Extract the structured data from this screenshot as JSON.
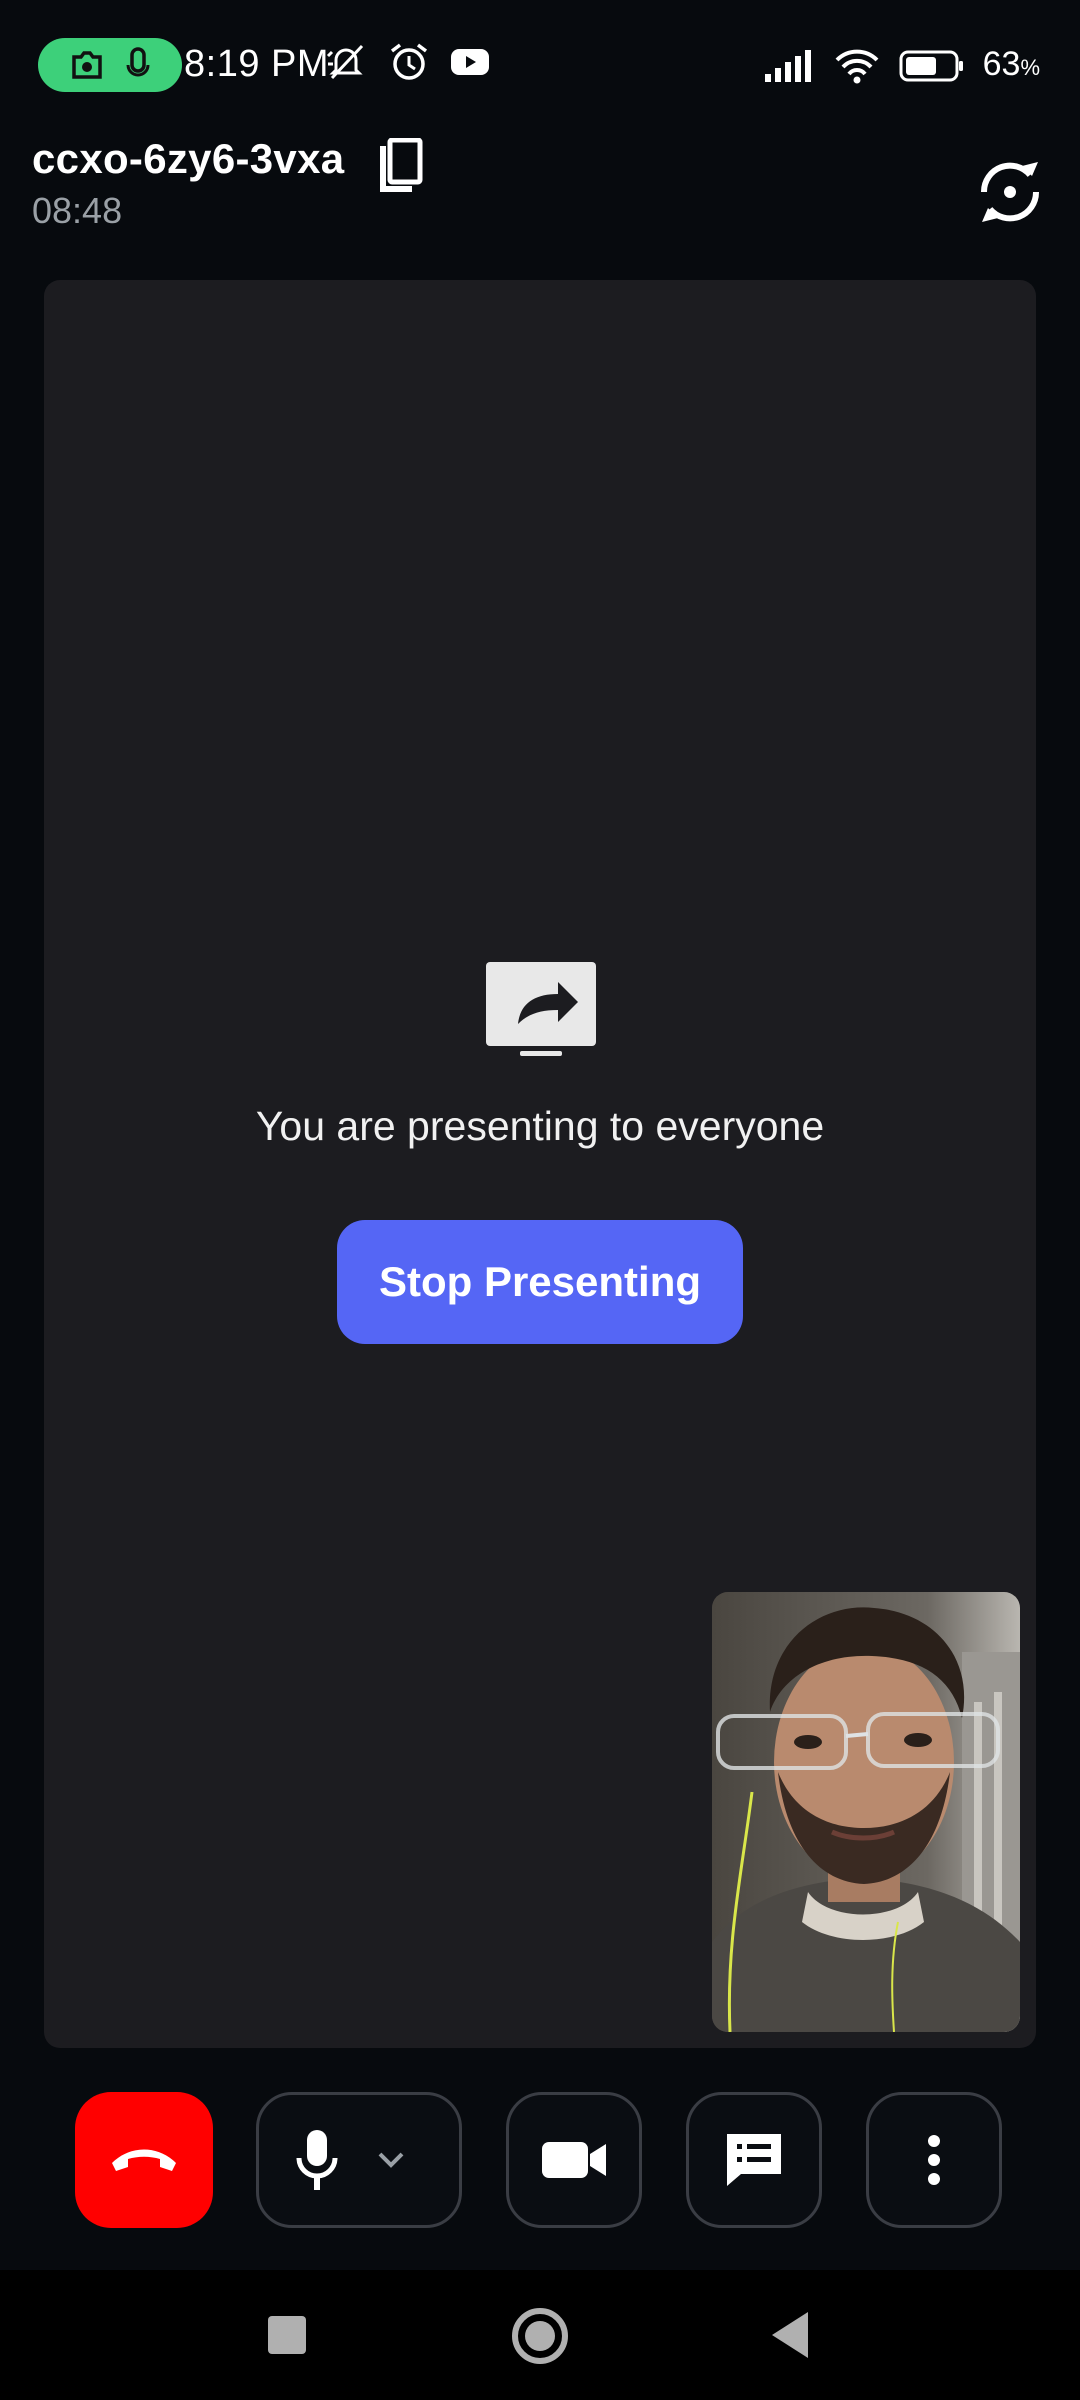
{
  "status_bar": {
    "time": "8:19 PM",
    "battery_percent": "63",
    "battery_unit": "%",
    "icons": [
      "camera-icon",
      "microphone-icon",
      "mute-icon",
      "alarm-icon",
      "youtube-icon",
      "signal-icon",
      "wifi-icon",
      "battery-icon"
    ],
    "recording_pill_color": "#3dd07a"
  },
  "header": {
    "meeting_code": "ccxo-6zy6-3vxa",
    "timer": "08:48",
    "icons": [
      "copy-icon",
      "switch-camera-icon"
    ]
  },
  "stage": {
    "presenting_message": "You are presenting to everyone",
    "stop_button_label": "Stop Presenting",
    "accent_color": "#5566f5",
    "icons": [
      "screen-share-icon"
    ]
  },
  "controls": {
    "icons": [
      "end-call-icon",
      "microphone-icon",
      "chevron-down-icon",
      "video-camera-icon",
      "chat-icon",
      "more-vert-icon"
    ],
    "end_call_color": "#ff0000"
  },
  "nav_bar": {
    "icons": [
      "recents-square-icon",
      "home-circle-icon",
      "back-triangle-icon"
    ]
  }
}
